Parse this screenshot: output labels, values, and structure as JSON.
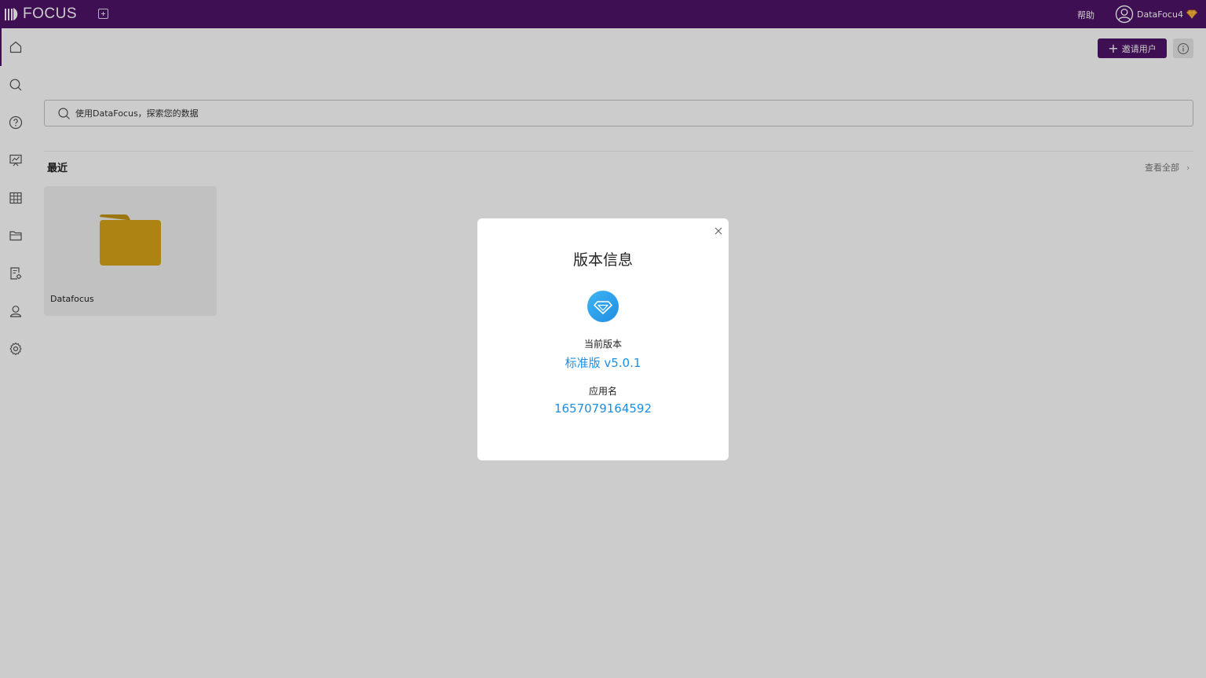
{
  "app": {
    "logo_text": "FOCUS"
  },
  "header": {
    "help_label": "帮助",
    "username": "DataFocu4"
  },
  "sidebar": {
    "items": [
      {
        "name": "home-icon"
      },
      {
        "name": "search-icon"
      },
      {
        "name": "question-icon"
      },
      {
        "name": "dashboard-icon"
      },
      {
        "name": "table-icon"
      },
      {
        "name": "folder-icon"
      },
      {
        "name": "data-settings-icon"
      },
      {
        "name": "user-icon"
      },
      {
        "name": "settings-icon"
      }
    ]
  },
  "main": {
    "invite_button_label": "邀请用户",
    "search_placeholder": "使用DataFocus，探索您的数据",
    "recent_title": "最近",
    "view_all_label": "查看全部",
    "recent_items": [
      {
        "name": "Datafocus",
        "type": "folder"
      }
    ]
  },
  "modal": {
    "title": "版本信息",
    "current_version_label": "当前版本",
    "current_version_value": "标准版 v5.0.1",
    "app_name_label": "应用名",
    "app_name_value": "1657079164592"
  },
  "colors": {
    "brand": "#4e1468",
    "accent_blue": "#1f8ee3",
    "folder": "#d9a51a"
  }
}
